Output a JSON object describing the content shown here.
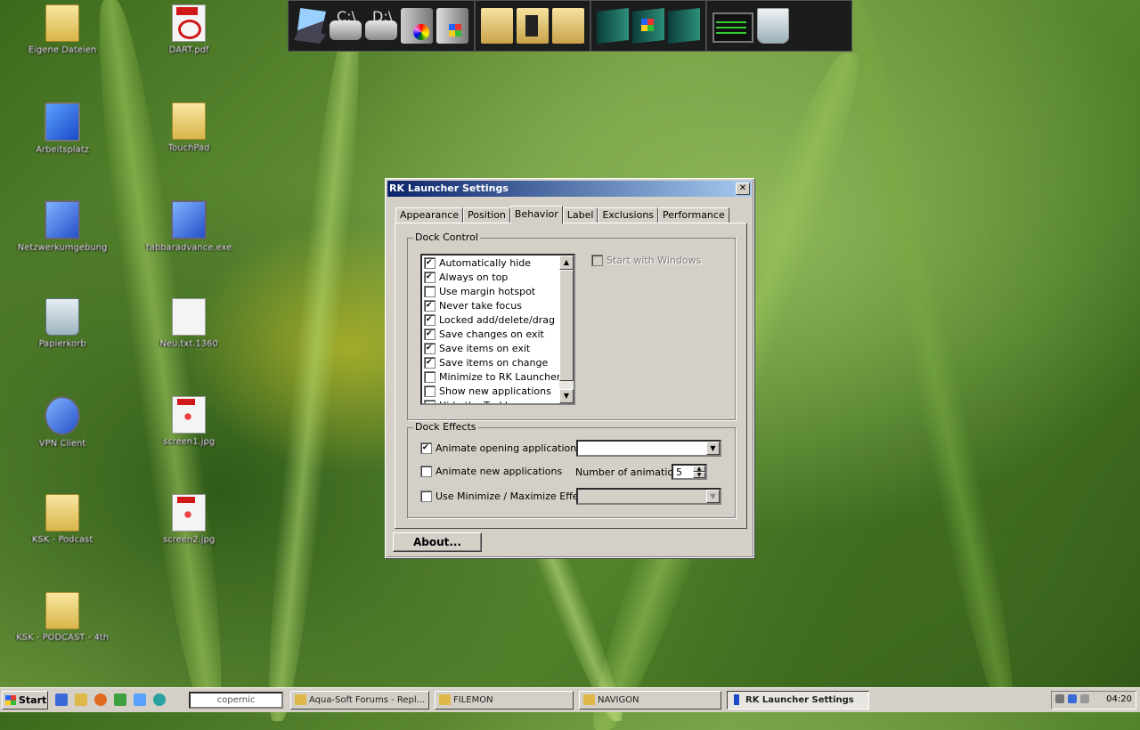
{
  "desktop": {
    "icons": [
      {
        "label": "Eigene Dateien",
        "kind": "folder"
      },
      {
        "label": "DART.pdf",
        "kind": "pdf"
      },
      {
        "label": "Arbeitsplatz",
        "kind": "monitor"
      },
      {
        "label": "TouchPad",
        "kind": "folder"
      },
      {
        "label": "Netzwerkumgebung",
        "kind": "network"
      },
      {
        "label": "tabbaradvance.exe",
        "kind": "app"
      },
      {
        "label": "Papierkorb",
        "kind": "bin"
      },
      {
        "label": "Neu.txt.1360",
        "kind": "doc"
      },
      {
        "label": "VPN Client",
        "kind": "vpn"
      },
      {
        "label": "screen1.jpg",
        "kind": "image"
      },
      {
        "label": "KSK - Podcast",
        "kind": "folder"
      },
      {
        "label": "screen2.jpg",
        "kind": "image"
      },
      {
        "label": "KSK - PODCAST - 4th",
        "kind": "folder"
      }
    ]
  },
  "dock": {
    "groups": [
      [
        "laptop-icon",
        "drive-c-icon",
        "drive-d-icon",
        "dvd-drive-icon",
        "windows-drive-icon"
      ],
      [
        "folder-icon",
        "media-folder-icon",
        "music-folder-icon"
      ],
      [
        "book-icon",
        "windows-book-icon",
        "tools-book-icon"
      ],
      [
        "task-monitor-icon",
        "recycle-bin-icon"
      ]
    ],
    "drive_c": "C:\\",
    "drive_d": "D:\\"
  },
  "dialog": {
    "title": "RK Launcher Settings",
    "close_label": "✕",
    "tabs": [
      "Appearance",
      "Position",
      "Behavior",
      "Label",
      "Exclusions",
      "Performance"
    ],
    "active_tab": "Behavior",
    "dock_control": {
      "title": "Dock Control",
      "options": [
        {
          "label": "Automatically hide",
          "checked": true
        },
        {
          "label": "Always on top",
          "checked": true
        },
        {
          "label": "Use margin hotspot",
          "checked": false
        },
        {
          "label": "Never take focus",
          "checked": true
        },
        {
          "label": "Locked add/delete/drag",
          "checked": true
        },
        {
          "label": "Save changes on exit",
          "checked": true
        },
        {
          "label": "Save items on exit",
          "checked": true
        },
        {
          "label": "Save items on change",
          "checked": true
        },
        {
          "label": "Minimize to RK Launcher",
          "checked": false
        },
        {
          "label": "Show new applications",
          "checked": false
        },
        {
          "label": "Hide the Taskbar",
          "checked": false
        }
      ],
      "start_with_windows": {
        "label": "Start with Windows",
        "checked": false,
        "disabled": true
      }
    },
    "dock_effects": {
      "title": "Dock Effects",
      "animate_opening": {
        "label": "Animate opening applications",
        "checked": true,
        "value": ""
      },
      "animate_new": {
        "label": "Animate new applications",
        "checked": false
      },
      "num_animations_label": "Number of animations",
      "num_animations_value": "5",
      "min_max": {
        "label": "Use Minimize / Maximize Effect",
        "checked": false,
        "value": ""
      }
    },
    "about_label": "About..."
  },
  "taskbar": {
    "start_label": "Start",
    "search_text": "copernic",
    "tasks": [
      {
        "label": "Aqua-Soft Forums - Repl..."
      },
      {
        "label": "FILEMON"
      },
      {
        "label": "NAVIGON"
      },
      {
        "label": "RK Launcher Settings",
        "active": true
      }
    ],
    "clock": "04:20"
  }
}
